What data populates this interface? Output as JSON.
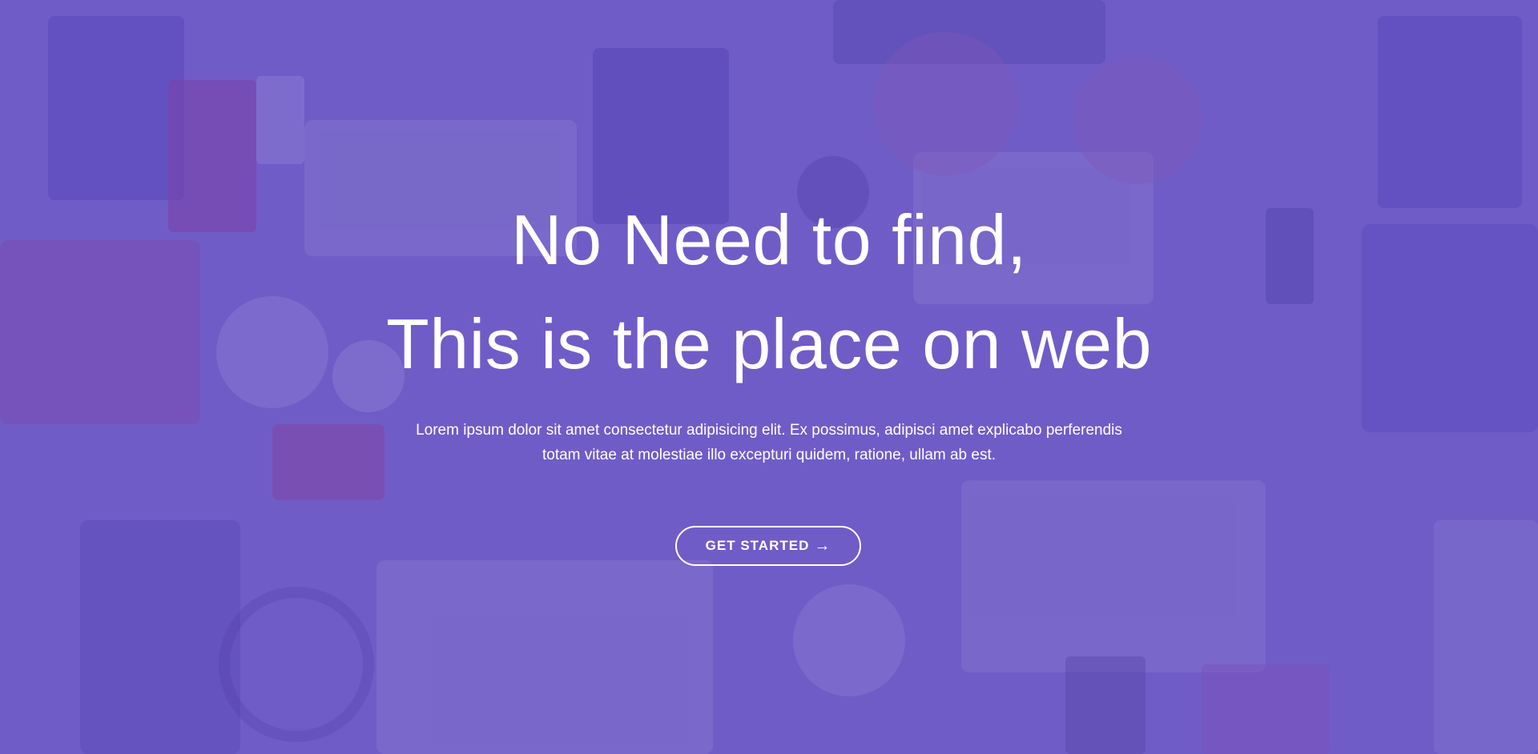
{
  "colors": {
    "overlay": "#6450c0",
    "text": "#ffffff"
  },
  "hero": {
    "headline_line1": "No Need to find,",
    "headline_line2": "This is the place on web",
    "lead_line1": "Lorem ipsum dolor sit amet consectetur adipisicing elit. Ex possimus, adipisci amet explicabo perferendis",
    "lead_line2": "totam vitae at molestiae illo excepturi quidem, ratione, ullam ab est.",
    "cta_label": "GET STARTED",
    "cta_icon": "arrow-right-icon",
    "cta_arrow": "→"
  }
}
